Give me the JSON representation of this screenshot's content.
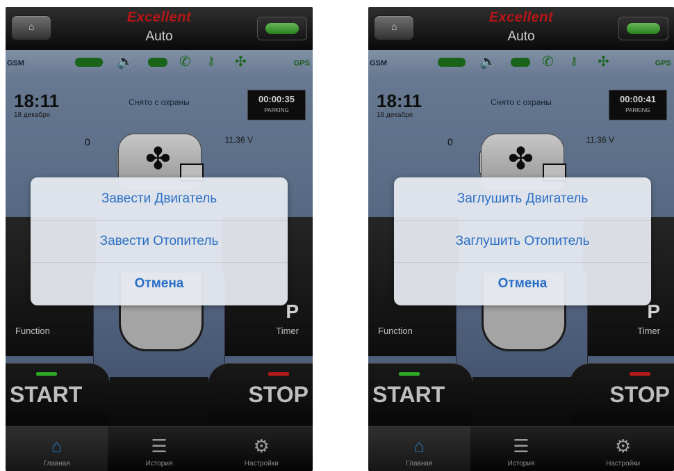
{
  "colors": {
    "brand_red": "#e01b1b",
    "accent_blue": "#2a6fc6",
    "status_green": "#1f7a1f",
    "start_led": "#39d030",
    "stop_led": "#e02020"
  },
  "screens": [
    {
      "header": {
        "brand": "Excellent",
        "title": "Auto"
      },
      "status": {
        "gsm": "GSM",
        "gps": "GPS"
      },
      "info": {
        "time": "18:11",
        "date": "18 декабря",
        "guard": "Снято с охраны",
        "timer": "00:00:35",
        "timer_sub": "PARKING"
      },
      "sensors": {
        "temp": "0",
        "voltage": "11.36 V"
      },
      "controls": {
        "function": "Function",
        "timer": "Timer",
        "start": "START",
        "stop": "STOP",
        "p": "P"
      },
      "tabs": {
        "home": "Главная",
        "history": "История",
        "settings": "Настройки"
      },
      "dialog": {
        "option1": "Завести Двигатель",
        "option2": "Завести Отопитель",
        "cancel": "Отмена"
      }
    },
    {
      "header": {
        "brand": "Excellent",
        "title": "Auto"
      },
      "status": {
        "gsm": "GSM",
        "gps": "GPS"
      },
      "info": {
        "time": "18:11",
        "date": "18 декабря",
        "guard": "Снято с охраны",
        "timer": "00:00:41",
        "timer_sub": "PARKING"
      },
      "sensors": {
        "temp": "0",
        "voltage": "11.36 V"
      },
      "controls": {
        "function": "Function",
        "timer": "Timer",
        "start": "START",
        "stop": "STOP",
        "p": "P"
      },
      "tabs": {
        "home": "Главная",
        "history": "История",
        "settings": "Настройки"
      },
      "dialog": {
        "option1": "Заглушить Двигатель",
        "option2": "Заглушить Отопитель",
        "cancel": "Отмена"
      }
    }
  ]
}
